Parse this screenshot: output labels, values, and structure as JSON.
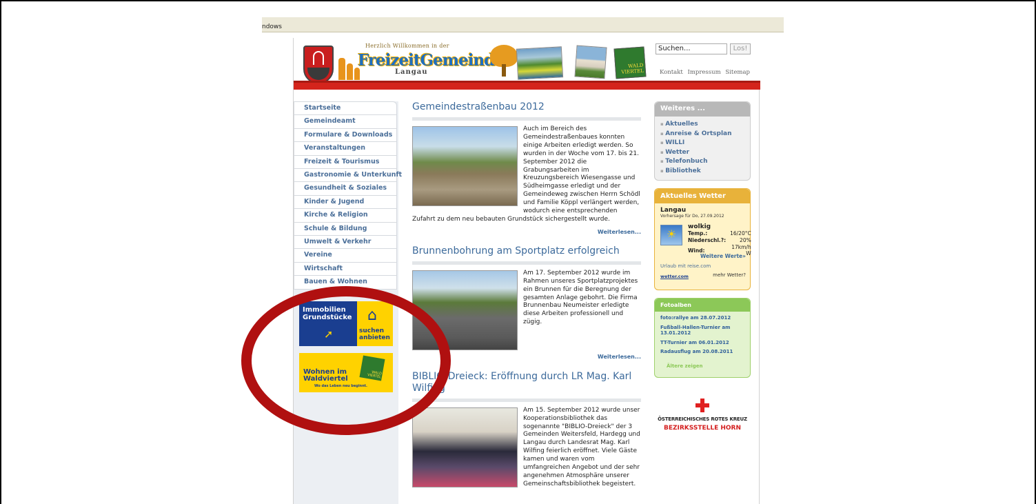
{
  "browser": {
    "window_text": "ndows"
  },
  "header": {
    "tagline": "Herzlich Willkommen in der",
    "logo": "FreizeitGemeinde",
    "logo_sub": "Langau",
    "badge": "WALD VIERTEL",
    "search_value": "Suchen...",
    "search_button": "Los!",
    "links": [
      "Kontakt",
      "Impressum",
      "Sitemap"
    ]
  },
  "nav": {
    "items": [
      "Startseite",
      "Gemeindeamt",
      "Formulare & Downloads",
      "Veranstaltungen",
      "Freizeit & Tourismus",
      "Gastronomie & Unterkunft",
      "Gesundheit & Soziales",
      "Kinder & Jugend",
      "Kirche & Religion",
      "Schule & Bildung",
      "Umwelt & Verkehr",
      "Vereine",
      "Wirtschaft",
      "Bauen & Wohnen"
    ]
  },
  "banners": {
    "immobilien_title": "Immobilien Grundstücke",
    "immobilien_action": "suchen anbieten",
    "wohnen_title": "Wohnen im Waldviertel",
    "wohnen_slogan": "Wo das Leben neu beginnt.",
    "wohnen_badge": "WALD VIERTEL"
  },
  "articles": [
    {
      "title": "Gemeindestraßenbau 2012",
      "text": "Auch im Bereich des Gemeindestraßenbaues konnten einige Arbeiten erledigt werden. So wurden in der Woche vom 17. bis 21. September 2012 die Grabungsarbeiten im Kreuzungsbereich Wiesengasse und Südheimgasse erledigt und der Gemeindeweg zwischen Herrn Schödl und Familie Köppl verlängert werden, wodurch eine entsprechenden Zufahrt zu dem neu bebauten Grundstück sichergestellt wurde.",
      "more": "Weiterlesen..."
    },
    {
      "title": "Brunnenbohrung am Sportplatz erfolgreich",
      "text": "Am 17. September 2012 wurde im Rahmen unseres Sportplatzprojektes ein Brunnen für die Beregnung der gesamten Anlage gebohrt. Die Firma Brunnenbau Neumeister erledigte diese Arbeiten professionell und zügig.",
      "more": "Weiterlesen..."
    },
    {
      "title": "BIBLIO-Dreieck: Eröffnung durch LR Mag. Karl Wilfing",
      "text": "Am 15. September 2012 wurde unser Kooperationsbibliothek das sogenannte \"BIBLIO-Dreieck\" der 3 Gemeinden Weitersfeld, Hardegg und Langau durch Landesrat Mag. Karl Wilfing feierlich eröffnet. Viele Gäste kamen und waren vom umfangreichen Angebot und der sehr angenehmen Atmosphäre unserer Gemeinschaftsbibliothek begeistert."
    }
  ],
  "sidebar": {
    "weiteres_title": "Weiteres ...",
    "weiteres_items": [
      "Aktuelles",
      "Anreise & Ortsplan",
      "WILLI",
      "Wetter",
      "Telefonbuch",
      "Bibliothek"
    ],
    "weather": {
      "title": "Aktuelles Wetter",
      "city": "Langau",
      "forecast": "Vorhersage für Do, 27.09.2012",
      "condition": "wolkig",
      "rows": [
        {
          "k": "Temp.:",
          "v": "16/20°C"
        },
        {
          "k": "Niederschl.?:",
          "v": "20%"
        },
        {
          "k": "Wind:",
          "v": "17km/h W"
        }
      ],
      "more_values": "Weitere Werte»",
      "urlaub": "Urlaub mit reise.com",
      "wetter_com": "wetter.com",
      "mehr": "mehr Wetter?"
    },
    "fotoalben": {
      "title": "Fotoalben",
      "items": [
        "foto:rallye am 28.07.2012",
        "Fußball-Hallen-Turnier am 13.01.2012",
        "TT-Turnier am 06.01.2012",
        "Radausflug am 20.08.2011"
      ],
      "older": "Ältere zeigen"
    },
    "rotes_kreuz": {
      "line1": "ÖSTERREICHISCHES ROTES KREUZ",
      "line2": "BEZIRKSSTELLE HORN"
    }
  },
  "colors": {
    "accent_red": "#d4241c",
    "link_blue": "#4b6f99",
    "annotation_ring": "#b01010"
  }
}
